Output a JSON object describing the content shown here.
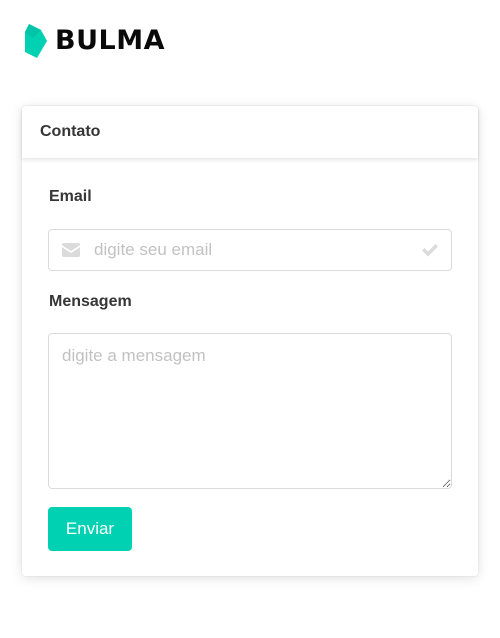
{
  "brand": {
    "name": "BULMA",
    "accent_color": "#00d1b2"
  },
  "card": {
    "title": "Contato"
  },
  "form": {
    "email": {
      "label": "Email",
      "placeholder": "digite seu email",
      "value": "",
      "left_icon": "envelope-icon",
      "right_icon": "check-icon"
    },
    "message": {
      "label": "Mensagem",
      "placeholder": "digite a mensagem",
      "value": ""
    },
    "submit_label": "Enviar"
  }
}
